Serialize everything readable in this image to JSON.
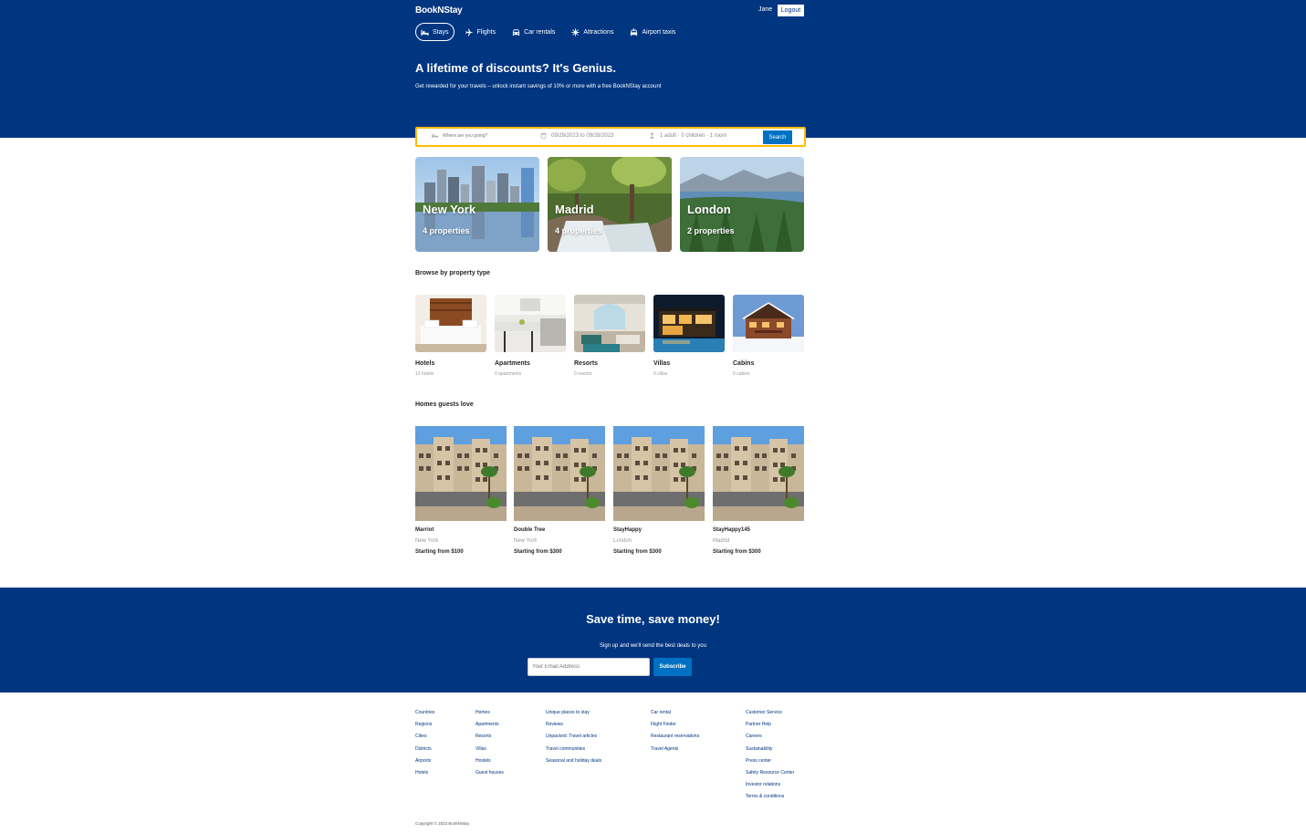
{
  "header": {
    "brand": "BookNStay",
    "user_name": "Jane",
    "logout_label": "Logout",
    "nav": [
      {
        "label": "Stays",
        "icon": "bed-icon",
        "active": true
      },
      {
        "label": "Flights",
        "icon": "plane-icon",
        "active": false
      },
      {
        "label": "Car rentals",
        "icon": "car-icon",
        "active": false
      },
      {
        "label": "Attractions",
        "icon": "attraction-icon",
        "active": false
      },
      {
        "label": "Airport taxis",
        "icon": "taxi-icon",
        "active": false
      }
    ],
    "hero_title": "A lifetime of discounts? It's Genius.",
    "hero_subtitle": "Get rewarded for your travels – unlock instant savings of 10% or more with a free BookNStay account"
  },
  "search": {
    "destination_placeholder": "Where are you going?",
    "dates": "09/28/2023 to 09/28/2023",
    "guests": "1 adult · 0 children · 1 room",
    "button_label": "Search"
  },
  "cities": [
    {
      "name": "New York",
      "count": "4 properties"
    },
    {
      "name": "Madrid",
      "count": "4 properties"
    },
    {
      "name": "London",
      "count": "2 properties"
    }
  ],
  "property_types": {
    "title": "Browse by property type",
    "items": [
      {
        "name": "Hotels",
        "count": "13 hotels"
      },
      {
        "name": "Apartments",
        "count": "0 apartments"
      },
      {
        "name": "Resorts",
        "count": "0 resorts"
      },
      {
        "name": "Villas",
        "count": "0 villas"
      },
      {
        "name": "Cabins",
        "count": "0 cabins"
      }
    ]
  },
  "homes": {
    "title": "Homes guests love",
    "items": [
      {
        "name": "Marriot",
        "city": "New York",
        "price": "Starting from $100"
      },
      {
        "name": "Double Tree",
        "city": "New York",
        "price": "Starting from $300"
      },
      {
        "name": "StayHappy",
        "city": "London",
        "price": "Starting from $300"
      },
      {
        "name": "StayHappy145",
        "city": "Madrid",
        "price": "Starting from $300"
      }
    ]
  },
  "newsletter": {
    "title": "Save time, save money!",
    "subtitle": "Sign up and we'll send the best deals to you",
    "email_placeholder": "Your Email Address",
    "button_label": "Subscribe"
  },
  "footer": {
    "columns": [
      [
        "Countries",
        "Regions",
        "Cities",
        "Districts",
        "Airports",
        "Hotels"
      ],
      [
        "Homes",
        "Apartments",
        "Resorts",
        "Villas",
        "Hostels",
        "Guest houses"
      ],
      [
        "Unique places to stay",
        "Reviews",
        "Unpacked: Travel articles",
        "Travel communities",
        "Seasonal and holiday deals"
      ],
      [
        "Car rental",
        "Flight Finder",
        "Restaurant reservations",
        "Travel Agents"
      ],
      [
        "Customer Service",
        "Partner Help",
        "Careers",
        "Sustainability",
        "Press center",
        "Safety Resource Center",
        "Investor relations",
        "Terms & conditions"
      ]
    ],
    "copyright": "Copyright © 2023 BookNStay."
  },
  "colors": {
    "brand_blue": "#003580",
    "button_blue": "#0071c2",
    "search_border": "#febb02"
  }
}
